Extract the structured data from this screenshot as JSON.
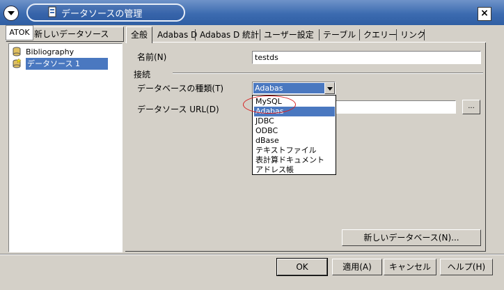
{
  "window": {
    "title": "データソースの管理",
    "close_glyph": "×"
  },
  "ime": {
    "label": "ATOK"
  },
  "left": {
    "new_datasource_label": "新しいデータソース",
    "tree_items": [
      {
        "label": "Bibliography",
        "icon": "database-icon",
        "selected": false
      },
      {
        "label": "データソース 1",
        "icon": "database-new-icon",
        "selected": true
      }
    ]
  },
  "tabs": [
    "全般",
    "Adabas D",
    "Adabas D 統計",
    "ユーザー設定",
    "テーブル",
    "クエリー",
    "リンク"
  ],
  "general": {
    "name_label": "名前(N)",
    "name_value": "testds",
    "connection_group": "接続",
    "dbtype_label": "データベースの種類(T)",
    "dbtype_value": "Adabas",
    "url_label": "データソース URL(D)",
    "url_value": "",
    "browse_label": "...",
    "new_database_label": "新しいデータベース(N)..."
  },
  "dropdown": {
    "options": [
      "MySQL",
      "Adabas",
      "JDBC",
      "ODBC",
      "dBase",
      "テキストファイル",
      "表計算ドキュメント",
      "アドレス帳"
    ],
    "selected_index": 1
  },
  "buttons": {
    "ok": "OK",
    "apply": "適用(A)",
    "cancel": "キャンセル",
    "help": "ヘルプ(H)"
  },
  "colors": {
    "selection": "#4a78c0",
    "annotation": "#d82020"
  }
}
